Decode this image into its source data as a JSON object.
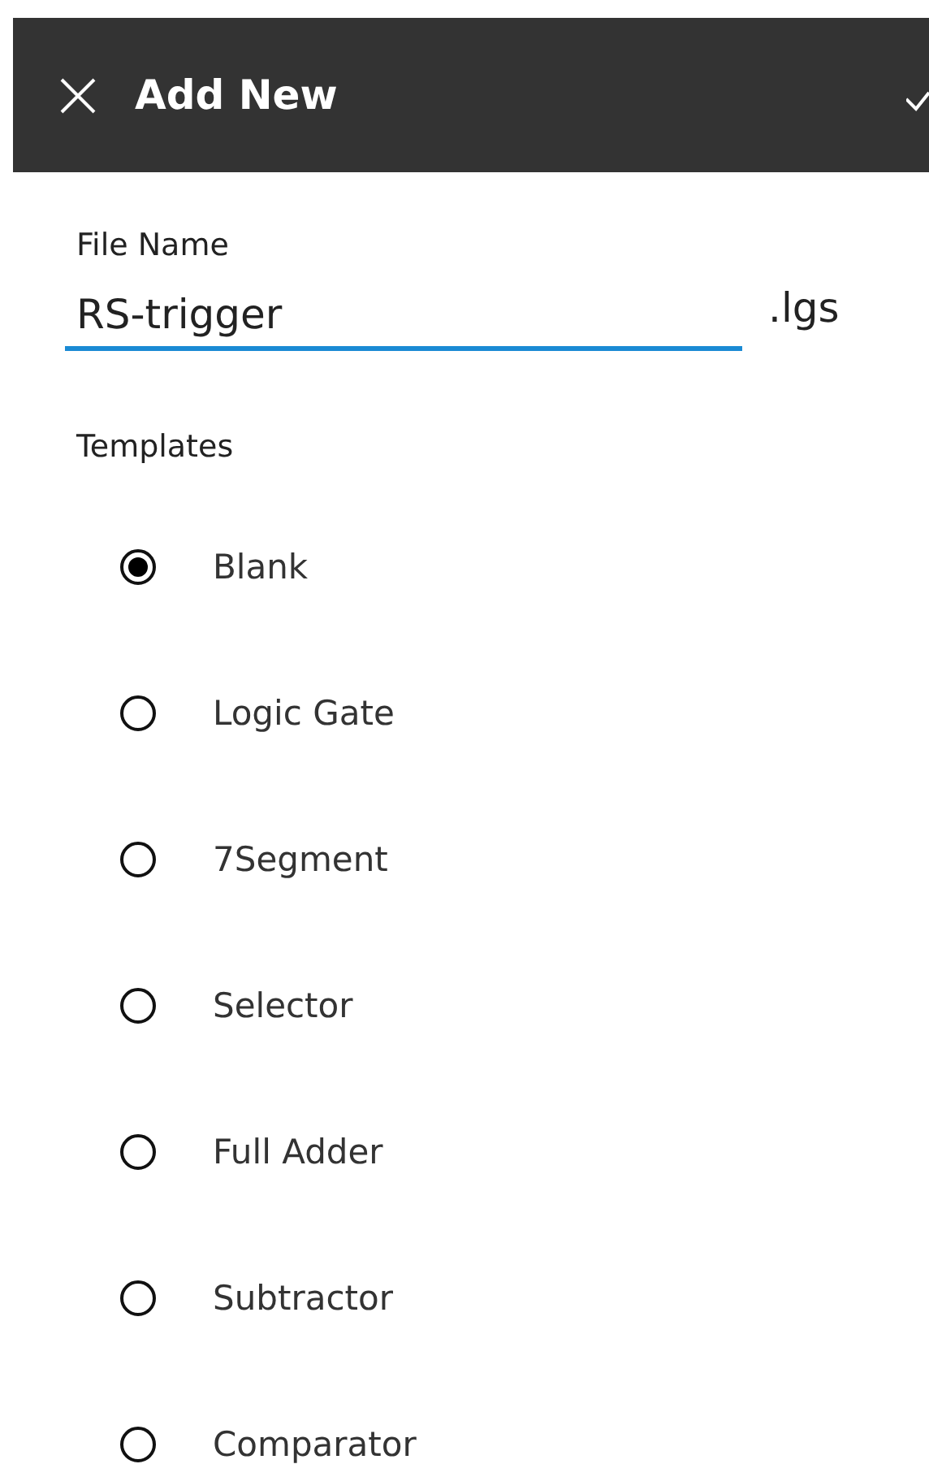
{
  "header": {
    "title": "Add New"
  },
  "file_name": {
    "label": "File Name",
    "value": "RS-trigger",
    "extension": ".lgs"
  },
  "templates": {
    "label": "Templates",
    "options": [
      {
        "label": "Blank",
        "selected": true
      },
      {
        "label": "Logic Gate",
        "selected": false
      },
      {
        "label": "7Segment",
        "selected": false
      },
      {
        "label": "Selector",
        "selected": false
      },
      {
        "label": "Full Adder",
        "selected": false
      },
      {
        "label": "Subtractor",
        "selected": false
      },
      {
        "label": "Comparator",
        "selected": false
      }
    ]
  }
}
